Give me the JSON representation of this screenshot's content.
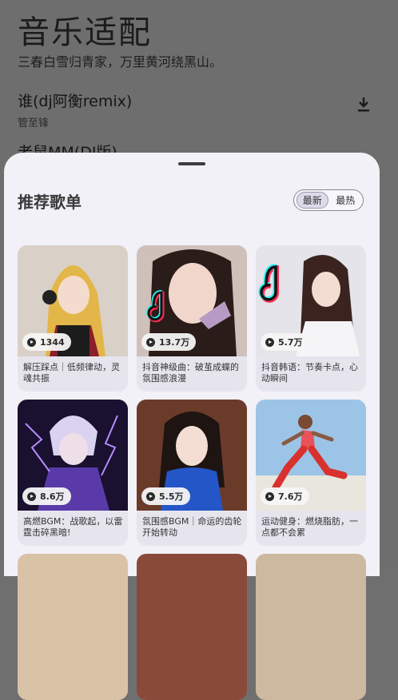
{
  "background": {
    "title": "音乐适配",
    "subtitle": "三春白雪归青家，万里黄河绕黑山。",
    "songs": [
      {
        "title": "谁(dj阿衡remix)",
        "artist": "管至锋"
      },
      {
        "title": "老鼠MM(DJ版)",
        "artist": ""
      }
    ]
  },
  "sheet": {
    "heading": "推荐歌单",
    "sort_options": [
      "最新",
      "最热"
    ],
    "active_sort": "最新"
  },
  "playlists": [
    {
      "count": "1344",
      "title": "解压踩点｜低频律动，灵魂共振"
    },
    {
      "count": "13.7万",
      "title": "抖音神级曲：破茧成蝶的氛围感浪漫"
    },
    {
      "count": "5.7万",
      "title": "抖音韩语：节奏卡点，心动瞬间"
    },
    {
      "count": "8.6万",
      "title": "高燃BGM：战歌起，以雷霆击碎黑暗!"
    },
    {
      "count": "5.5万",
      "title": "氛围感BGM｜命运的齿轮开始转动"
    },
    {
      "count": "7.6万",
      "title": "运动健身：燃烧脂肪，一点都不会累"
    }
  ],
  "colors": {
    "sheet_bg": "#f1f1f7",
    "dim_bg": "#6e6e6e",
    "card_bg": "#e6e5ee"
  }
}
